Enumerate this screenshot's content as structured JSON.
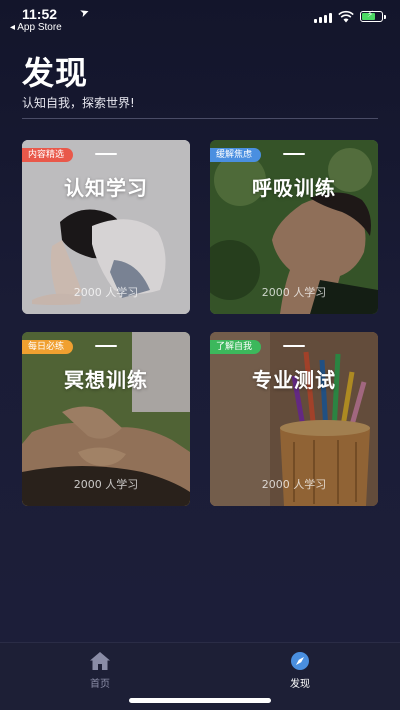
{
  "status_bar": {
    "time": "11:52",
    "back_app": "◂ App Store",
    "battery_level": 0.7
  },
  "page": {
    "title": "发现",
    "subtitle": "认知自我，探索世界!"
  },
  "cards": [
    {
      "tag": "内容精选",
      "title": "认知学习",
      "count": "2000 人学习",
      "tag_color": "#e9584a"
    },
    {
      "tag": "缓解焦虑",
      "title": "呼吸训练",
      "count": "2000 人学习",
      "tag_color": "#4a8fe0"
    },
    {
      "tag": "每日必练",
      "title": "冥想训练",
      "count": "2000 人学习",
      "tag_color": "#f0a030"
    },
    {
      "tag": "了解自我",
      "title": "专业测试",
      "count": "2000 人学习",
      "tag_color": "#3cb85c"
    }
  ],
  "tabbar": {
    "items": [
      {
        "label": "首页",
        "icon": "home-icon",
        "active": false
      },
      {
        "label": "发现",
        "icon": "compass-icon",
        "active": true
      }
    ]
  },
  "colors": {
    "background": "#1a1c36",
    "active_tab": "#ffffff",
    "inactive_tab": "#8a8ca6"
  }
}
